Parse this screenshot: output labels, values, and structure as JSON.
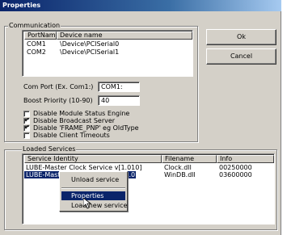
{
  "window": {
    "title": "Properties"
  },
  "communication": {
    "legend": "Communication",
    "columns": [
      "PortName",
      "Device name"
    ],
    "rows": [
      {
        "port": "COM1",
        "device": "\\Device\\PCISerial0"
      },
      {
        "port": "COM2",
        "device": "\\Device\\PCISerial1"
      }
    ],
    "com_port_label": "Com Port (Ex. Com1:)",
    "com_port_value": "COM1:",
    "boost_label": "Boost Priority (10-90)",
    "boost_value": "40",
    "checkboxes": [
      {
        "label": "Disable Module Status Engine",
        "checked": false
      },
      {
        "label": "Disable Broadcast Server",
        "checked": true
      },
      {
        "label": "Disable 'FRAME_PNP' eg OldType",
        "checked": true
      },
      {
        "label": "Disable Client Timeouts",
        "checked": false
      }
    ]
  },
  "buttons": {
    "ok": "Ok",
    "cancel": "Cancel"
  },
  "services": {
    "legend": "Loaded Services",
    "columns": [
      "Service Identity",
      "Filename",
      "Info"
    ],
    "rows": [
      {
        "identity": "LUBE-Master Clock Service v[1.010]",
        "filename": "Clock.dll",
        "info": "00250000"
      },
      {
        "identity": "LUBE-Master WinDB Service v[1.010]",
        "filename": "WinDB.dll",
        "info": "03600000"
      }
    ]
  },
  "context_menu": {
    "items": [
      "Unload service",
      "Properties",
      "Load new service"
    ],
    "highlighted": "Properties"
  },
  "colors": {
    "title_start": "#0a246a",
    "selection": "#0a246a",
    "face": "#d4d0c8"
  }
}
